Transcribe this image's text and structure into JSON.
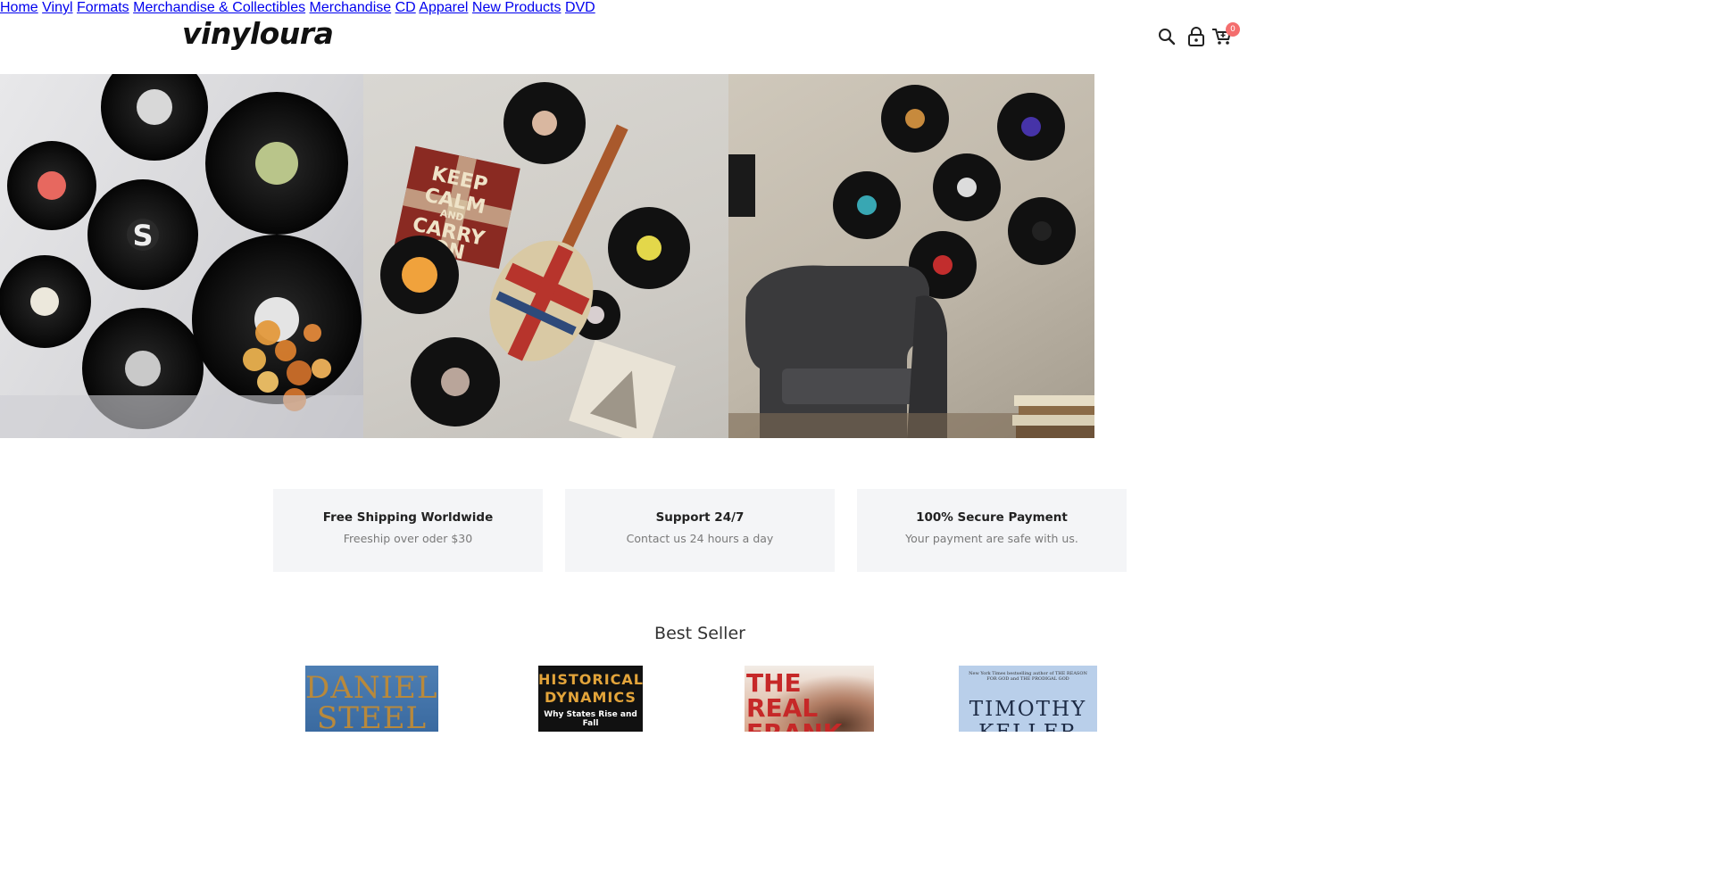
{
  "header": {
    "logo": "vinyloura",
    "nav": [
      "Home",
      "Vinyl",
      "Formats",
      "Merchandise & Collectibles",
      "Merchandise",
      "CD",
      "Apparel",
      "New Products",
      "DVD"
    ],
    "cart_count": "0",
    "icons": [
      "search-icon",
      "lock-icon",
      "cart-icon"
    ]
  },
  "features": [
    {
      "title": "Free Shipping Worldwide",
      "subtitle": "Freeship over oder $30"
    },
    {
      "title": "Support 24/7",
      "subtitle": "Contact us 24 hours a day"
    },
    {
      "title": "100% Secure Payment",
      "subtitle": "Your payment are safe with us."
    }
  ],
  "best_seller": {
    "title": "Best Seller",
    "books": [
      {
        "cover_text": "DANIELLE STEEL"
      },
      {
        "cover_text": "HISTORICAL DYNAMICS",
        "cover_sub": "Why States Rise and Fall"
      },
      {
        "cover_text": "THE REAL FRANK"
      },
      {
        "cover_text": "TIMOTHY KELLER",
        "cover_sub": "New York Times bestselling author of THE REASON FOR GOD and THE PRODIGAL GOD"
      }
    ]
  },
  "hero": {
    "record_labels": [
      "S"
    ],
    "sign_text": [
      "KEEP",
      "CALM",
      "AND",
      "CARRY",
      "ON"
    ]
  }
}
